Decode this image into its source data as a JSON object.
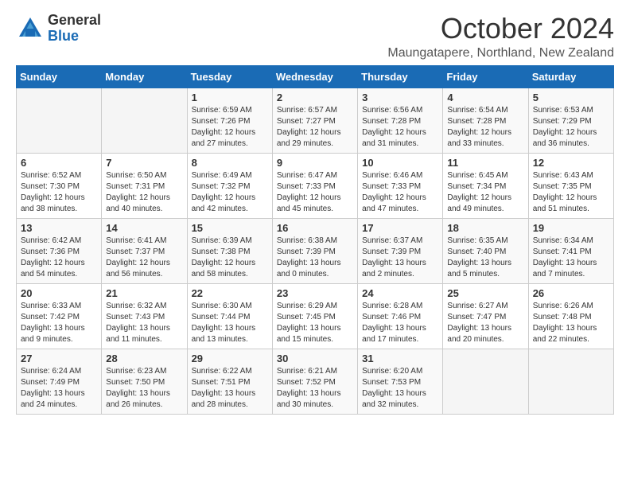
{
  "logo": {
    "general": "General",
    "blue": "Blue"
  },
  "title": "October 2024",
  "location": "Maungatapere, Northland, New Zealand",
  "headers": [
    "Sunday",
    "Monday",
    "Tuesday",
    "Wednesday",
    "Thursday",
    "Friday",
    "Saturday"
  ],
  "weeks": [
    [
      {
        "day": "",
        "info": ""
      },
      {
        "day": "",
        "info": ""
      },
      {
        "day": "1",
        "info": "Sunrise: 6:59 AM\nSunset: 7:26 PM\nDaylight: 12 hours and 27 minutes."
      },
      {
        "day": "2",
        "info": "Sunrise: 6:57 AM\nSunset: 7:27 PM\nDaylight: 12 hours and 29 minutes."
      },
      {
        "day": "3",
        "info": "Sunrise: 6:56 AM\nSunset: 7:28 PM\nDaylight: 12 hours and 31 minutes."
      },
      {
        "day": "4",
        "info": "Sunrise: 6:54 AM\nSunset: 7:28 PM\nDaylight: 12 hours and 33 minutes."
      },
      {
        "day": "5",
        "info": "Sunrise: 6:53 AM\nSunset: 7:29 PM\nDaylight: 12 hours and 36 minutes."
      }
    ],
    [
      {
        "day": "6",
        "info": "Sunrise: 6:52 AM\nSunset: 7:30 PM\nDaylight: 12 hours and 38 minutes."
      },
      {
        "day": "7",
        "info": "Sunrise: 6:50 AM\nSunset: 7:31 PM\nDaylight: 12 hours and 40 minutes."
      },
      {
        "day": "8",
        "info": "Sunrise: 6:49 AM\nSunset: 7:32 PM\nDaylight: 12 hours and 42 minutes."
      },
      {
        "day": "9",
        "info": "Sunrise: 6:47 AM\nSunset: 7:33 PM\nDaylight: 12 hours and 45 minutes."
      },
      {
        "day": "10",
        "info": "Sunrise: 6:46 AM\nSunset: 7:33 PM\nDaylight: 12 hours and 47 minutes."
      },
      {
        "day": "11",
        "info": "Sunrise: 6:45 AM\nSunset: 7:34 PM\nDaylight: 12 hours and 49 minutes."
      },
      {
        "day": "12",
        "info": "Sunrise: 6:43 AM\nSunset: 7:35 PM\nDaylight: 12 hours and 51 minutes."
      }
    ],
    [
      {
        "day": "13",
        "info": "Sunrise: 6:42 AM\nSunset: 7:36 PM\nDaylight: 12 hours and 54 minutes."
      },
      {
        "day": "14",
        "info": "Sunrise: 6:41 AM\nSunset: 7:37 PM\nDaylight: 12 hours and 56 minutes."
      },
      {
        "day": "15",
        "info": "Sunrise: 6:39 AM\nSunset: 7:38 PM\nDaylight: 12 hours and 58 minutes."
      },
      {
        "day": "16",
        "info": "Sunrise: 6:38 AM\nSunset: 7:39 PM\nDaylight: 13 hours and 0 minutes."
      },
      {
        "day": "17",
        "info": "Sunrise: 6:37 AM\nSunset: 7:39 PM\nDaylight: 13 hours and 2 minutes."
      },
      {
        "day": "18",
        "info": "Sunrise: 6:35 AM\nSunset: 7:40 PM\nDaylight: 13 hours and 5 minutes."
      },
      {
        "day": "19",
        "info": "Sunrise: 6:34 AM\nSunset: 7:41 PM\nDaylight: 13 hours and 7 minutes."
      }
    ],
    [
      {
        "day": "20",
        "info": "Sunrise: 6:33 AM\nSunset: 7:42 PM\nDaylight: 13 hours and 9 minutes."
      },
      {
        "day": "21",
        "info": "Sunrise: 6:32 AM\nSunset: 7:43 PM\nDaylight: 13 hours and 11 minutes."
      },
      {
        "day": "22",
        "info": "Sunrise: 6:30 AM\nSunset: 7:44 PM\nDaylight: 13 hours and 13 minutes."
      },
      {
        "day": "23",
        "info": "Sunrise: 6:29 AM\nSunset: 7:45 PM\nDaylight: 13 hours and 15 minutes."
      },
      {
        "day": "24",
        "info": "Sunrise: 6:28 AM\nSunset: 7:46 PM\nDaylight: 13 hours and 17 minutes."
      },
      {
        "day": "25",
        "info": "Sunrise: 6:27 AM\nSunset: 7:47 PM\nDaylight: 13 hours and 20 minutes."
      },
      {
        "day": "26",
        "info": "Sunrise: 6:26 AM\nSunset: 7:48 PM\nDaylight: 13 hours and 22 minutes."
      }
    ],
    [
      {
        "day": "27",
        "info": "Sunrise: 6:24 AM\nSunset: 7:49 PM\nDaylight: 13 hours and 24 minutes."
      },
      {
        "day": "28",
        "info": "Sunrise: 6:23 AM\nSunset: 7:50 PM\nDaylight: 13 hours and 26 minutes."
      },
      {
        "day": "29",
        "info": "Sunrise: 6:22 AM\nSunset: 7:51 PM\nDaylight: 13 hours and 28 minutes."
      },
      {
        "day": "30",
        "info": "Sunrise: 6:21 AM\nSunset: 7:52 PM\nDaylight: 13 hours and 30 minutes."
      },
      {
        "day": "31",
        "info": "Sunrise: 6:20 AM\nSunset: 7:53 PM\nDaylight: 13 hours and 32 minutes."
      },
      {
        "day": "",
        "info": ""
      },
      {
        "day": "",
        "info": ""
      }
    ]
  ]
}
